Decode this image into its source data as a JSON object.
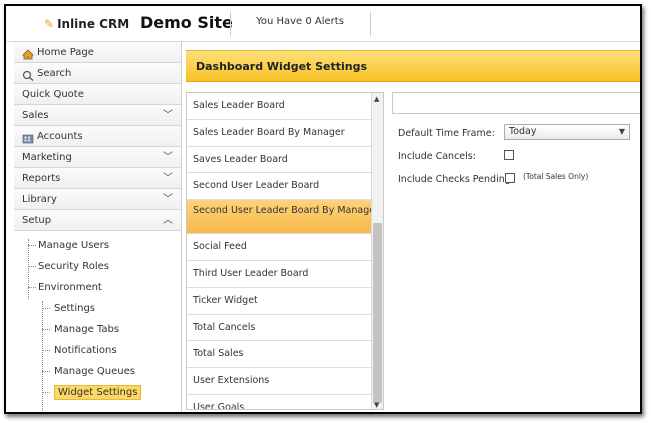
{
  "header": {
    "logo_text": "Inline CRM",
    "site_title": "Demo Site",
    "alerts_text": "You Have 0 Alerts"
  },
  "sidebar": {
    "items": [
      {
        "label": "Home Page",
        "icon": "home-icon"
      },
      {
        "label": "Search",
        "icon": "search-icon"
      },
      {
        "label": "Quick Quote"
      },
      {
        "label": "Sales",
        "chevron": "down"
      },
      {
        "label": "Accounts",
        "icon": "accounts-icon"
      },
      {
        "label": "Marketing",
        "chevron": "down"
      },
      {
        "label": "Reports",
        "chevron": "down"
      },
      {
        "label": "Library",
        "chevron": "down"
      },
      {
        "label": "Setup",
        "chevron": "up"
      }
    ],
    "tree": [
      {
        "label": "Manage Users"
      },
      {
        "label": "Security Roles"
      },
      {
        "label": "Environment"
      },
      {
        "label": "Settings"
      },
      {
        "label": "Manage Tabs"
      },
      {
        "label": "Notifications"
      },
      {
        "label": "Manage Queues"
      },
      {
        "label": "Widget Settings",
        "selected": true
      }
    ]
  },
  "main": {
    "title": "Dashboard Widget Settings",
    "widgets": [
      "Sales Leader Board",
      "Sales Leader Board By Manager",
      "Saves Leader Board",
      "Second User Leader Board",
      "Second User Leader Board By Manager",
      "Social Feed",
      "Third User Leader Board",
      "Ticker Widget",
      "Total Cancels",
      "Total Sales",
      "User Extensions",
      "User Goals"
    ],
    "selected_widget_index": 4
  },
  "settings": {
    "time_frame_label": "Default Time Frame:",
    "time_frame_value": "Today",
    "include_cancels_label": "Include Cancels:",
    "include_checks_label": "Include Checks Pending:",
    "include_checks_note": "(Total Sales Only)"
  },
  "colors": {
    "accent": "#f8c227",
    "selected_item": "#fcd867"
  }
}
